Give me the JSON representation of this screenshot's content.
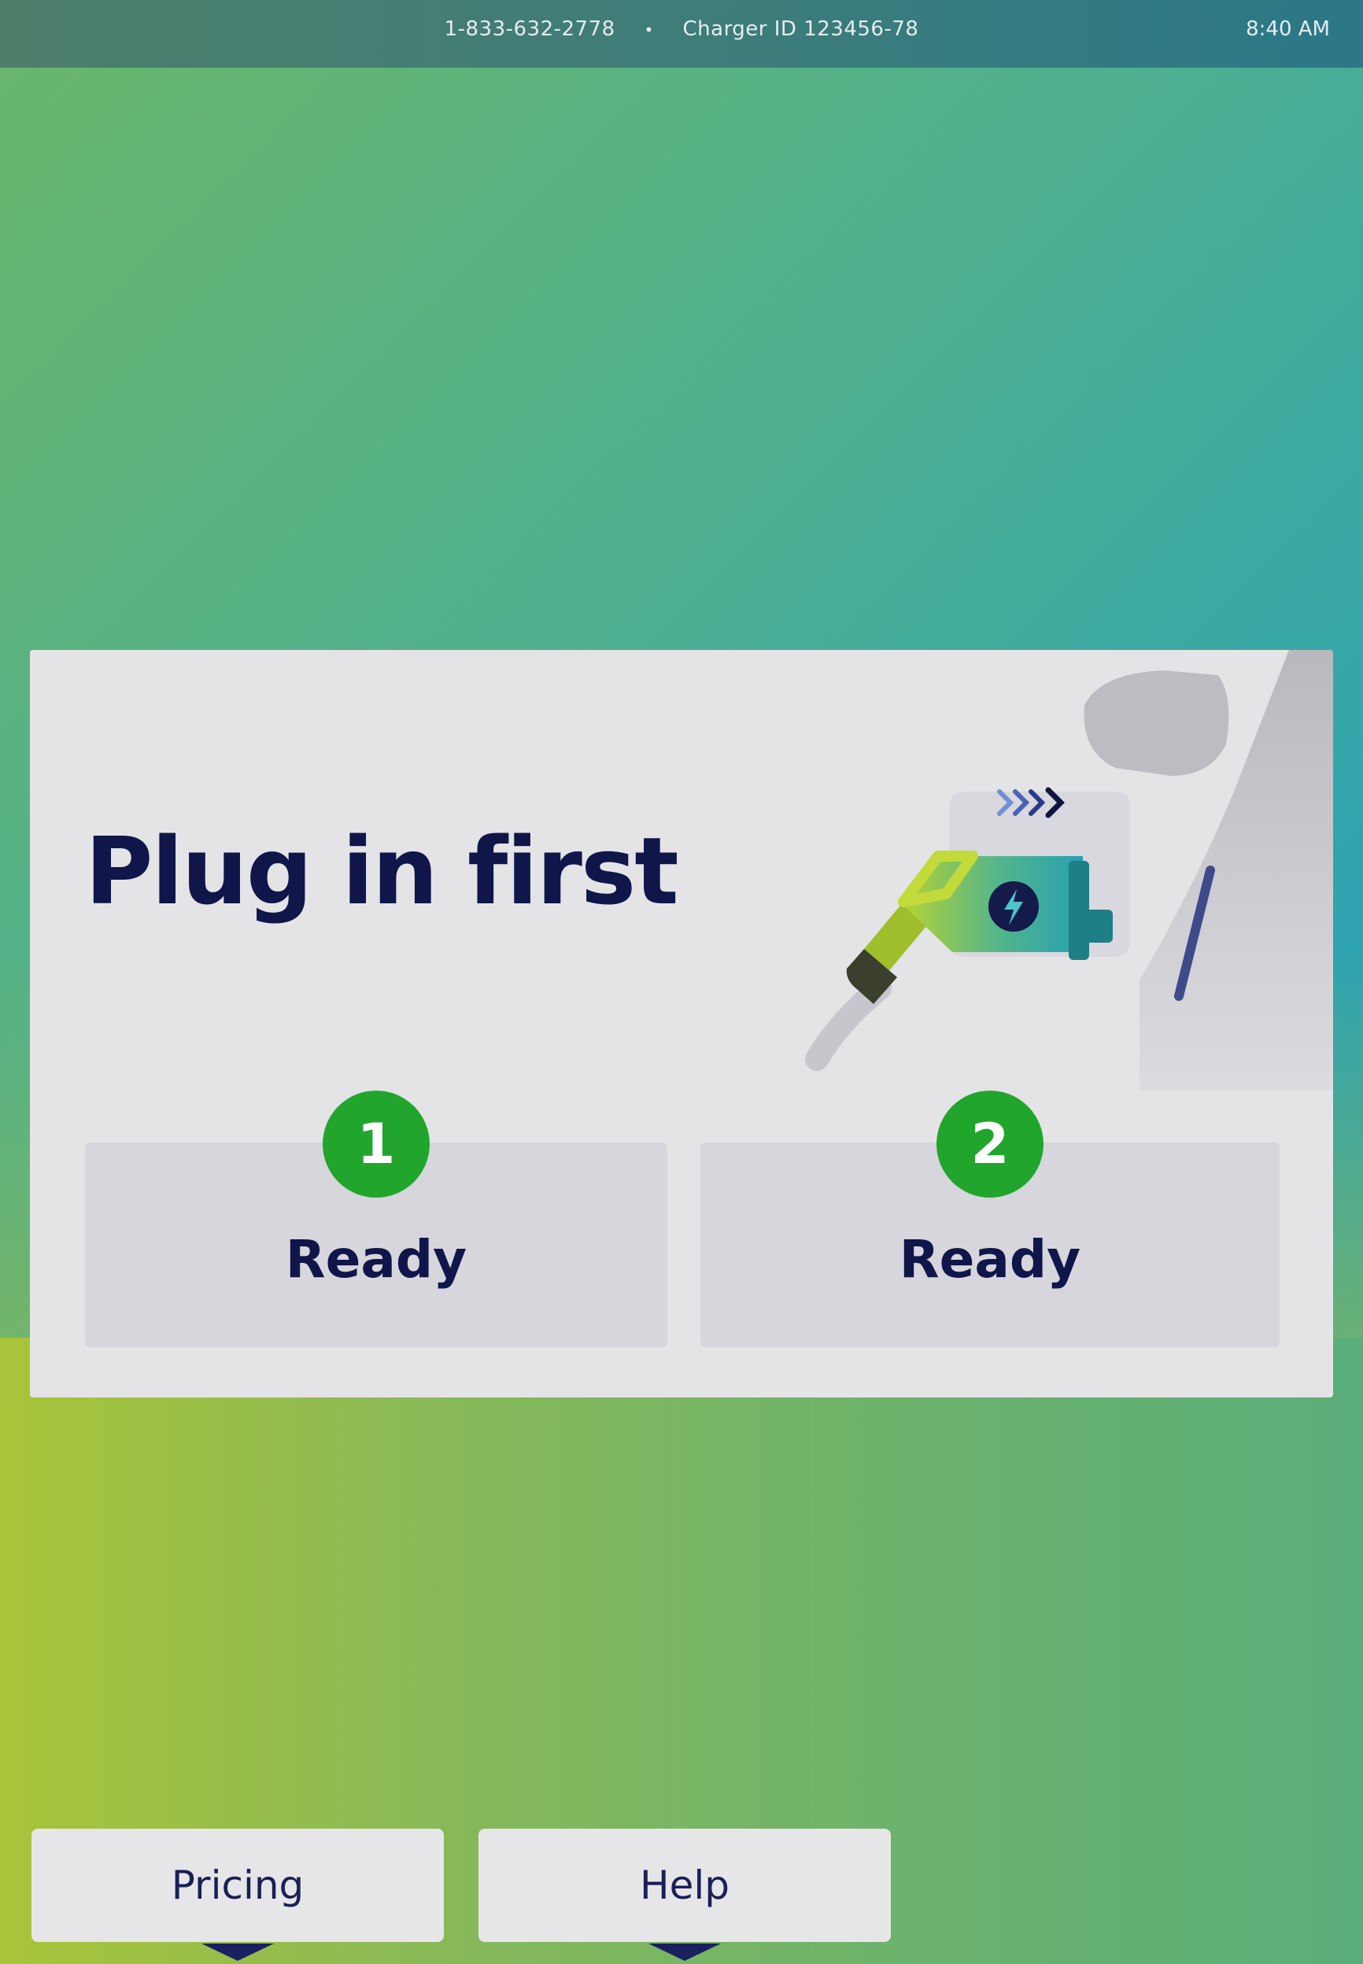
{
  "status_bar": {
    "phone": "1-833-632-2778",
    "separator": "•",
    "charger_id": "Charger ID 123456-78",
    "time": "8:40 AM"
  },
  "card": {
    "title": "Plug in first",
    "illustration": "ev-charger-plug-illustration",
    "ports": [
      {
        "number": "1",
        "status": "Ready"
      },
      {
        "number": "2",
        "status": "Ready"
      }
    ]
  },
  "bottom_nav": {
    "pricing_label": "Pricing",
    "help_label": "Help"
  },
  "colors": {
    "badge_green": "#22a52c",
    "text_navy": "#10154a",
    "card_bg": "#e4e4e6"
  }
}
